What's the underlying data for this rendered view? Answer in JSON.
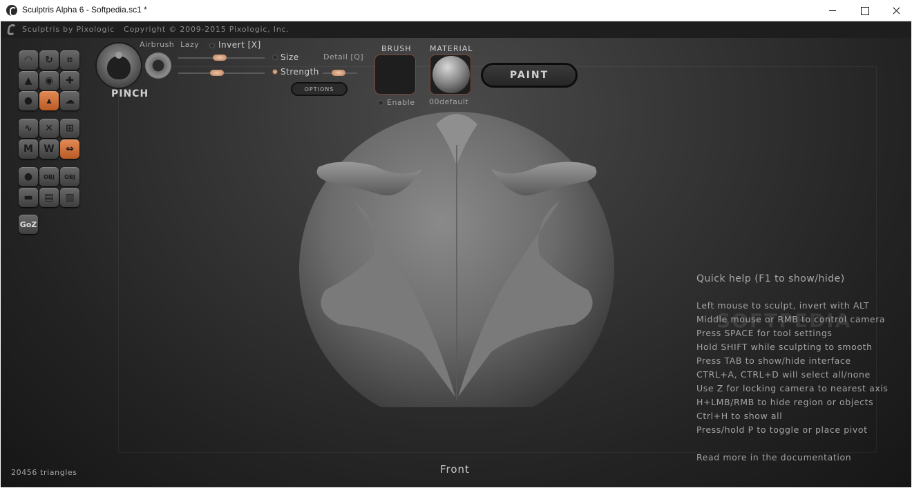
{
  "window": {
    "title": "Sculptris Alpha 6 - Softpedia.sc1 *"
  },
  "appbar": {
    "brand": "Sculptris by Pixologic",
    "copyright": "Copyright © 2009-2015 Pixologic, Inc."
  },
  "toolbar_left": {
    "tools": [
      {
        "name": "draw-tool-icon",
        "glyph": "◠",
        "active": false
      },
      {
        "name": "rotate-tool-icon",
        "glyph": "↻",
        "active": false
      },
      {
        "name": "crop-tool-icon",
        "glyph": "⌗",
        "active": false
      },
      {
        "name": "flatten-tool-icon",
        "glyph": "▲",
        "active": false
      },
      {
        "name": "inflate-tool-icon",
        "glyph": "◉",
        "active": false
      },
      {
        "name": "move-tool-icon",
        "glyph": "✚",
        "active": false
      },
      {
        "name": "smooth-tool-icon",
        "glyph": "●",
        "active": false
      },
      {
        "name": "pinch-tool-icon",
        "glyph": "▴",
        "active": true
      },
      {
        "name": "crease-tool-icon",
        "glyph": "☁",
        "active": false
      },
      {
        "name": "symmetry-tool-icon",
        "glyph": "∿",
        "active": false
      },
      {
        "name": "hide-tool-icon",
        "glyph": "✕",
        "active": false
      },
      {
        "name": "grid-tool-icon",
        "glyph": "⊞",
        "active": false
      },
      {
        "name": "mask-tool-icon",
        "glyph": "M",
        "active": false
      },
      {
        "name": "reduce-tool-icon",
        "glyph": "W",
        "active": false
      },
      {
        "name": "mirror-tool-icon",
        "glyph": "⇔",
        "active": true
      },
      {
        "name": "new-sphere-icon",
        "glyph": "●",
        "active": false
      },
      {
        "name": "import-obj-icon",
        "glyph": "OBJ",
        "active": false
      },
      {
        "name": "export-obj-icon",
        "glyph": "OBJ",
        "active": false
      },
      {
        "name": "new-plane-icon",
        "glyph": "▬",
        "active": false
      },
      {
        "name": "open-file-icon",
        "glyph": "▤",
        "active": false
      },
      {
        "name": "save-file-icon",
        "glyph": "▥",
        "active": false
      },
      {
        "name": "goz-icon",
        "glyph": "GoZ",
        "active": false
      }
    ]
  },
  "brush": {
    "name": "PINCH",
    "airbrush": "Airbrush",
    "lazy": "Lazy",
    "invert": "Invert [X]",
    "size": "Size",
    "strength": "Strength",
    "detail": "Detail [Q]",
    "options": "OPTIONS",
    "size_value": 0.48,
    "strength_value": 0.45,
    "detail_value": 0.45
  },
  "brush_section": {
    "title": "BRUSH",
    "enable": "Enable"
  },
  "material_section": {
    "title": "MATERIAL",
    "name": "00default"
  },
  "paint_button": "PAINT",
  "quick_help": {
    "title": "Quick help (F1 to show/hide)",
    "lines": [
      "Left mouse to sculpt, invert with ALT",
      "Middle mouse or RMB to control camera",
      "Press SPACE for tool settings",
      "Hold SHIFT while sculpting to smooth",
      "Press TAB to show/hide interface",
      "CTRL+A, CTRL+D will select all/none",
      "Use Z for locking camera to nearest axis",
      "H+LMB/RMB to hide region or objects",
      "Ctrl+H to show all",
      "Press/hold P to toggle or place pivot"
    ],
    "more": "Read more in the documentation"
  },
  "watermark": "SOFTPEDIA",
  "status": {
    "triangles": "20456 triangles",
    "view": "Front"
  }
}
